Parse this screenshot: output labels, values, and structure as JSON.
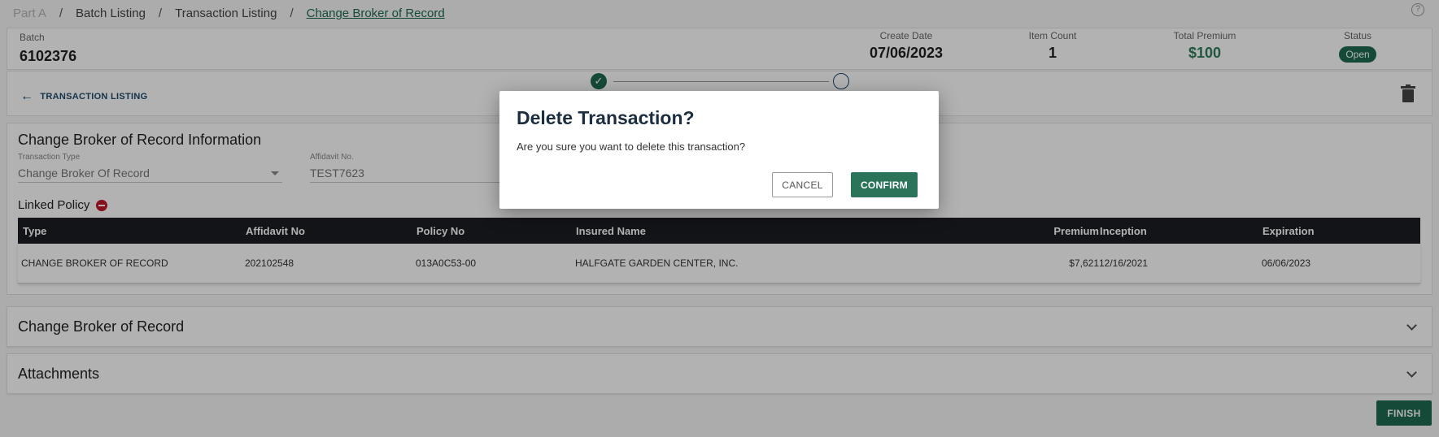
{
  "breadcrumb": {
    "items": [
      "Part A",
      "Batch Listing",
      "Transaction Listing",
      "Change Broker of Record"
    ],
    "separator": "/"
  },
  "help_icon_text": "?",
  "batch": {
    "batch_label": "Batch",
    "batch_value": "6102376",
    "create_date_label": "Create Date",
    "create_date_value": "07/06/2023",
    "item_count_label": "Item Count",
    "item_count_value": "1",
    "total_premium_label": "Total Premium",
    "total_premium_value": "$100",
    "status_label": "Status",
    "status_value": "Open"
  },
  "stepbar": {
    "back_label": "TRANSACTION LISTING",
    "back_icon": "arrow-left-icon",
    "steps": [
      {
        "state": "complete",
        "icon": "check-icon"
      },
      {
        "state": "pending",
        "icon": "circle-icon"
      }
    ],
    "delete_icon": "trash-icon"
  },
  "info": {
    "title": "Change Broker of Record Information",
    "transaction_type_label": "Transaction Type",
    "transaction_type_value": "Change Broker Of Record",
    "affidavit_label": "Affidavit No.",
    "affidavit_value": "TEST7623",
    "linked_policy_label": "Linked Policy"
  },
  "table": {
    "headers": [
      "Type",
      "Affidavit No",
      "Policy No",
      "Insured Name",
      "Premium",
      "Inception",
      "Expiration"
    ],
    "rows": [
      [
        "CHANGE BROKER OF RECORD",
        "202102548",
        "013A0C53-00",
        "HALFGATE GARDEN CENTER, INC.",
        "$7,621",
        "12/16/2021",
        "06/06/2023"
      ]
    ]
  },
  "sections": [
    {
      "title": "Change Broker of Record"
    },
    {
      "title": "Attachments"
    }
  ],
  "finish_label": "FINISH",
  "dialog": {
    "title": "Delete Transaction?",
    "message": "Are you sure you want to delete this transaction?",
    "cancel_label": "CANCEL",
    "confirm_label": "CONFIRM"
  },
  "colors": {
    "brand_green": "#1f6b52",
    "header_dark": "#1a1d22",
    "danger_red": "#c0182a"
  }
}
